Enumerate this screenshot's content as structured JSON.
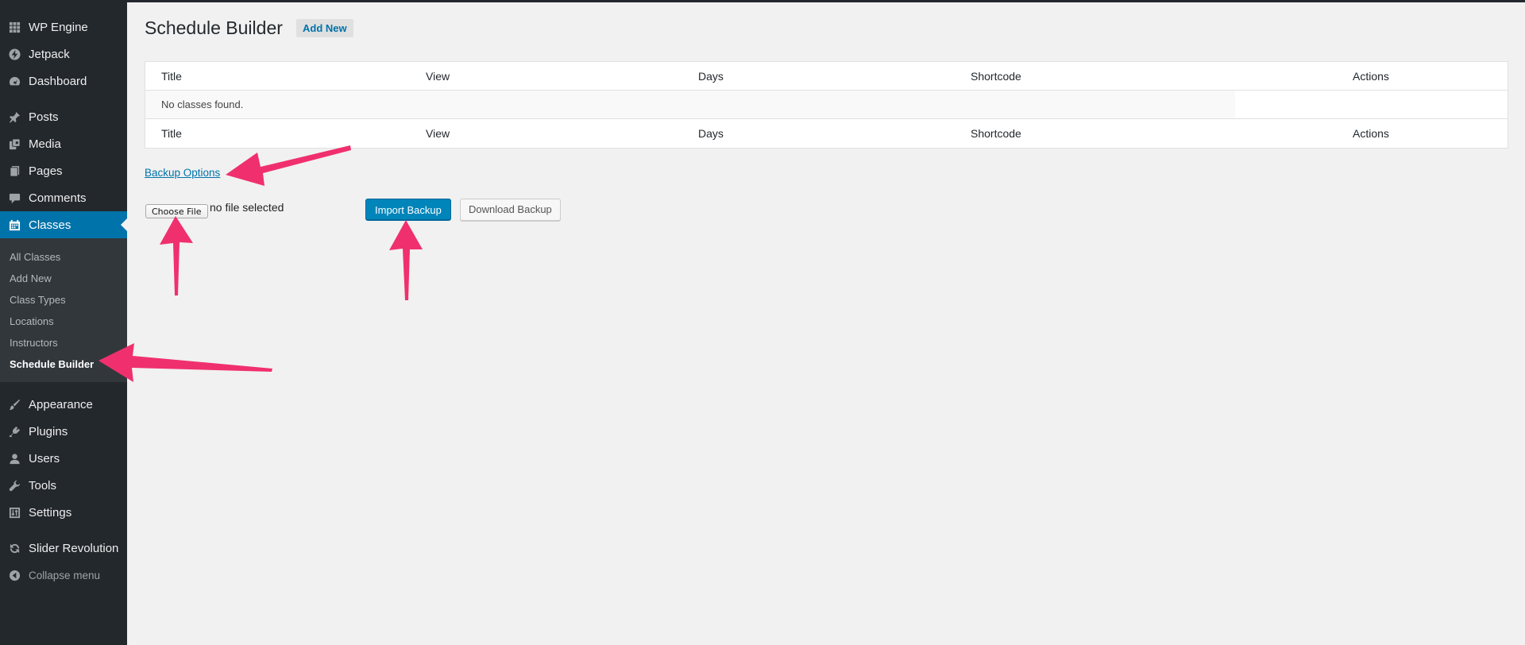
{
  "sidebar": {
    "items": [
      {
        "label": "WP Engine",
        "icon": "grid-icon"
      },
      {
        "label": "Jetpack",
        "icon": "bolt-icon"
      },
      {
        "label": "Dashboard",
        "icon": "dashboard-icon"
      },
      {
        "label": "Posts",
        "icon": "pin-icon"
      },
      {
        "label": "Media",
        "icon": "media-icon"
      },
      {
        "label": "Pages",
        "icon": "pages-icon"
      },
      {
        "label": "Comments",
        "icon": "comment-icon"
      },
      {
        "label": "Classes",
        "icon": "calendar-icon"
      },
      {
        "label": "Appearance",
        "icon": "brush-icon"
      },
      {
        "label": "Plugins",
        "icon": "plug-icon"
      },
      {
        "label": "Users",
        "icon": "user-icon"
      },
      {
        "label": "Tools",
        "icon": "wrench-icon"
      },
      {
        "label": "Settings",
        "icon": "sliders-icon"
      },
      {
        "label": "Slider Revolution",
        "icon": "refresh-icon"
      }
    ],
    "current_item": "Classes",
    "submenu": [
      "All Classes",
      "Add New",
      "Class Types",
      "Locations",
      "Instructors",
      "Schedule Builder"
    ],
    "submenu_current": "Schedule Builder",
    "collapse_label": "Collapse menu"
  },
  "page": {
    "title": "Schedule Builder",
    "add_new_label": "Add New"
  },
  "table": {
    "columns": [
      "Title",
      "View",
      "Days",
      "Shortcode",
      "Actions"
    ],
    "empty_message": "No classes found."
  },
  "backup": {
    "link_label": "Backup Options",
    "choose_file_label": "Choose File",
    "file_status": "no file selected",
    "import_label": "Import Backup",
    "download_label": "Download Backup"
  },
  "colors": {
    "sidebar_bg": "#23282d",
    "submenu_bg": "#32373c",
    "accent": "#0073aa",
    "primary_button": "#0085ba",
    "annotation_arrow": "#f0306e",
    "page_bg": "#f1f1f1"
  }
}
